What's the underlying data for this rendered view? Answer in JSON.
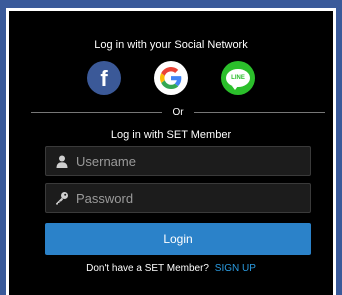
{
  "social": {
    "title": "Log in with your Social Network",
    "providers": [
      {
        "name": "facebook",
        "icon": "facebook-icon",
        "glyph": "f",
        "color": "#3b5998"
      },
      {
        "name": "google",
        "icon": "google-icon",
        "glyph": "G",
        "color": "#ffffff"
      },
      {
        "name": "line",
        "icon": "line-icon",
        "glyph": "LINE",
        "color": "#2bbf2b"
      }
    ]
  },
  "divider": {
    "text": "Or"
  },
  "member": {
    "title": "Log in with SET Member",
    "username_placeholder": "Username",
    "password_placeholder": "Password",
    "login_label": "Login"
  },
  "signup": {
    "prompt": "Don't have a SET Member?",
    "link_label": "SIGN UP"
  },
  "colors": {
    "background": "#3a5a9a",
    "panel": "#000000",
    "accent": "#2b82c9",
    "link": "#2b9be0"
  }
}
